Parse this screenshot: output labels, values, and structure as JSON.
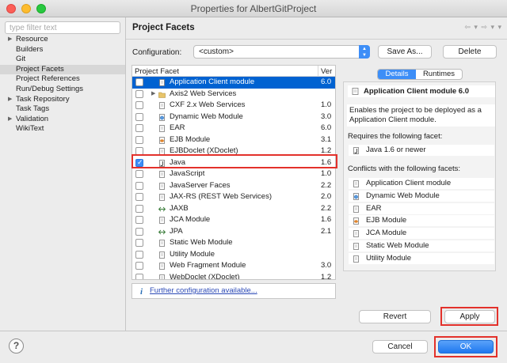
{
  "window": {
    "title": "Properties for AlbertGitProject"
  },
  "filter": {
    "placeholder": "type filter text"
  },
  "nav": [
    {
      "label": "Resource",
      "expandable": true,
      "selected": false
    },
    {
      "label": "Builders",
      "expandable": false,
      "selected": false
    },
    {
      "label": "Git",
      "expandable": false,
      "selected": false
    },
    {
      "label": "Project Facets",
      "expandable": false,
      "selected": true
    },
    {
      "label": "Project References",
      "expandable": false,
      "selected": false
    },
    {
      "label": "Run/Debug Settings",
      "expandable": false,
      "selected": false
    },
    {
      "label": "Task Repository",
      "expandable": true,
      "selected": false
    },
    {
      "label": "Task Tags",
      "expandable": false,
      "selected": false
    },
    {
      "label": "Validation",
      "expandable": true,
      "selected": false
    },
    {
      "label": "WikiText",
      "expandable": false,
      "selected": false
    }
  ],
  "page": {
    "title": "Project Facets",
    "nav_arrows": "⇦ ▾ ⇨ ▾ ▾"
  },
  "configuration": {
    "label": "Configuration:",
    "value": "<custom>",
    "save_as": "Save As...",
    "delete": "Delete"
  },
  "facets": {
    "col_facet": "Project Facet",
    "col_version": "Ver",
    "rows": [
      {
        "name": "Application Client module",
        "version": "6.0",
        "checked": false,
        "selected": true,
        "expandable": false,
        "icon": "page-icon"
      },
      {
        "name": "Axis2 Web Services",
        "version": "",
        "checked": false,
        "selected": false,
        "expandable": true,
        "icon": "folder-icon"
      },
      {
        "name": "CXF 2.x Web Services",
        "version": "1.0",
        "checked": false,
        "selected": false,
        "expandable": false,
        "icon": "page-icon"
      },
      {
        "name": "Dynamic Web Module",
        "version": "3.0",
        "checked": false,
        "selected": false,
        "expandable": false,
        "icon": "web-icon"
      },
      {
        "name": "EAR",
        "version": "6.0",
        "checked": false,
        "selected": false,
        "expandable": false,
        "icon": "page-icon"
      },
      {
        "name": "EJB Module",
        "version": "3.1",
        "checked": false,
        "selected": false,
        "expandable": false,
        "icon": "bean-icon"
      },
      {
        "name": "EJBDoclet (XDoclet)",
        "version": "1.2",
        "checked": false,
        "selected": false,
        "expandable": false,
        "icon": "page-icon"
      },
      {
        "name": "Java",
        "version": "1.6",
        "checked": true,
        "selected": false,
        "expandable": false,
        "icon": "java-icon"
      },
      {
        "name": "JavaScript",
        "version": "1.0",
        "checked": false,
        "selected": false,
        "expandable": false,
        "icon": "page-icon"
      },
      {
        "name": "JavaServer Faces",
        "version": "2.2",
        "checked": false,
        "selected": false,
        "expandable": false,
        "icon": "page-icon"
      },
      {
        "name": "JAX-RS (REST Web Services)",
        "version": "2.0",
        "checked": false,
        "selected": false,
        "expandable": false,
        "icon": "page-icon"
      },
      {
        "name": "JAXB",
        "version": "2.2",
        "checked": false,
        "selected": false,
        "expandable": false,
        "icon": "arrows-icon"
      },
      {
        "name": "JCA Module",
        "version": "1.6",
        "checked": false,
        "selected": false,
        "expandable": false,
        "icon": "page-icon"
      },
      {
        "name": "JPA",
        "version": "2.1",
        "checked": false,
        "selected": false,
        "expandable": false,
        "icon": "arrows-icon"
      },
      {
        "name": "Static Web Module",
        "version": "",
        "checked": false,
        "selected": false,
        "expandable": false,
        "icon": "page-icon"
      },
      {
        "name": "Utility Module",
        "version": "",
        "checked": false,
        "selected": false,
        "expandable": false,
        "icon": "page-icon"
      },
      {
        "name": "Web Fragment Module",
        "version": "3.0",
        "checked": false,
        "selected": false,
        "expandable": false,
        "icon": "page-icon"
      },
      {
        "name": "WebDoclet (XDoclet)",
        "version": "1.2",
        "checked": false,
        "selected": false,
        "expandable": false,
        "icon": "page-icon"
      }
    ]
  },
  "further": {
    "link": "Further configuration available..."
  },
  "tabs": {
    "details": "Details",
    "runtimes": "Runtimes"
  },
  "details": {
    "title": "Application Client module 6.0",
    "description": "Enables the project to be deployed as a\nApplication Client module.",
    "requires_label": "Requires the following facet:",
    "requires": [
      {
        "name": "Java 1.6 or newer",
        "icon": "java-icon"
      }
    ],
    "conflicts_label": "Conflicts with the following facets:",
    "conflicts": [
      {
        "name": "Application Client module",
        "icon": "page-icon"
      },
      {
        "name": "Dynamic Web Module",
        "icon": "web-icon"
      },
      {
        "name": "EAR",
        "icon": "page-icon"
      },
      {
        "name": "EJB Module",
        "icon": "bean-icon"
      },
      {
        "name": "JCA Module",
        "icon": "page-icon"
      },
      {
        "name": "Static Web Module",
        "icon": "page-icon"
      },
      {
        "name": "Utility Module",
        "icon": "page-icon"
      }
    ]
  },
  "buttons": {
    "revert": "Revert",
    "apply": "Apply",
    "cancel": "Cancel",
    "ok": "OK",
    "help": "?"
  },
  "colors": {
    "accent": "#3d8ef7",
    "selection": "#0062d1",
    "highlight": "#e3312b"
  }
}
